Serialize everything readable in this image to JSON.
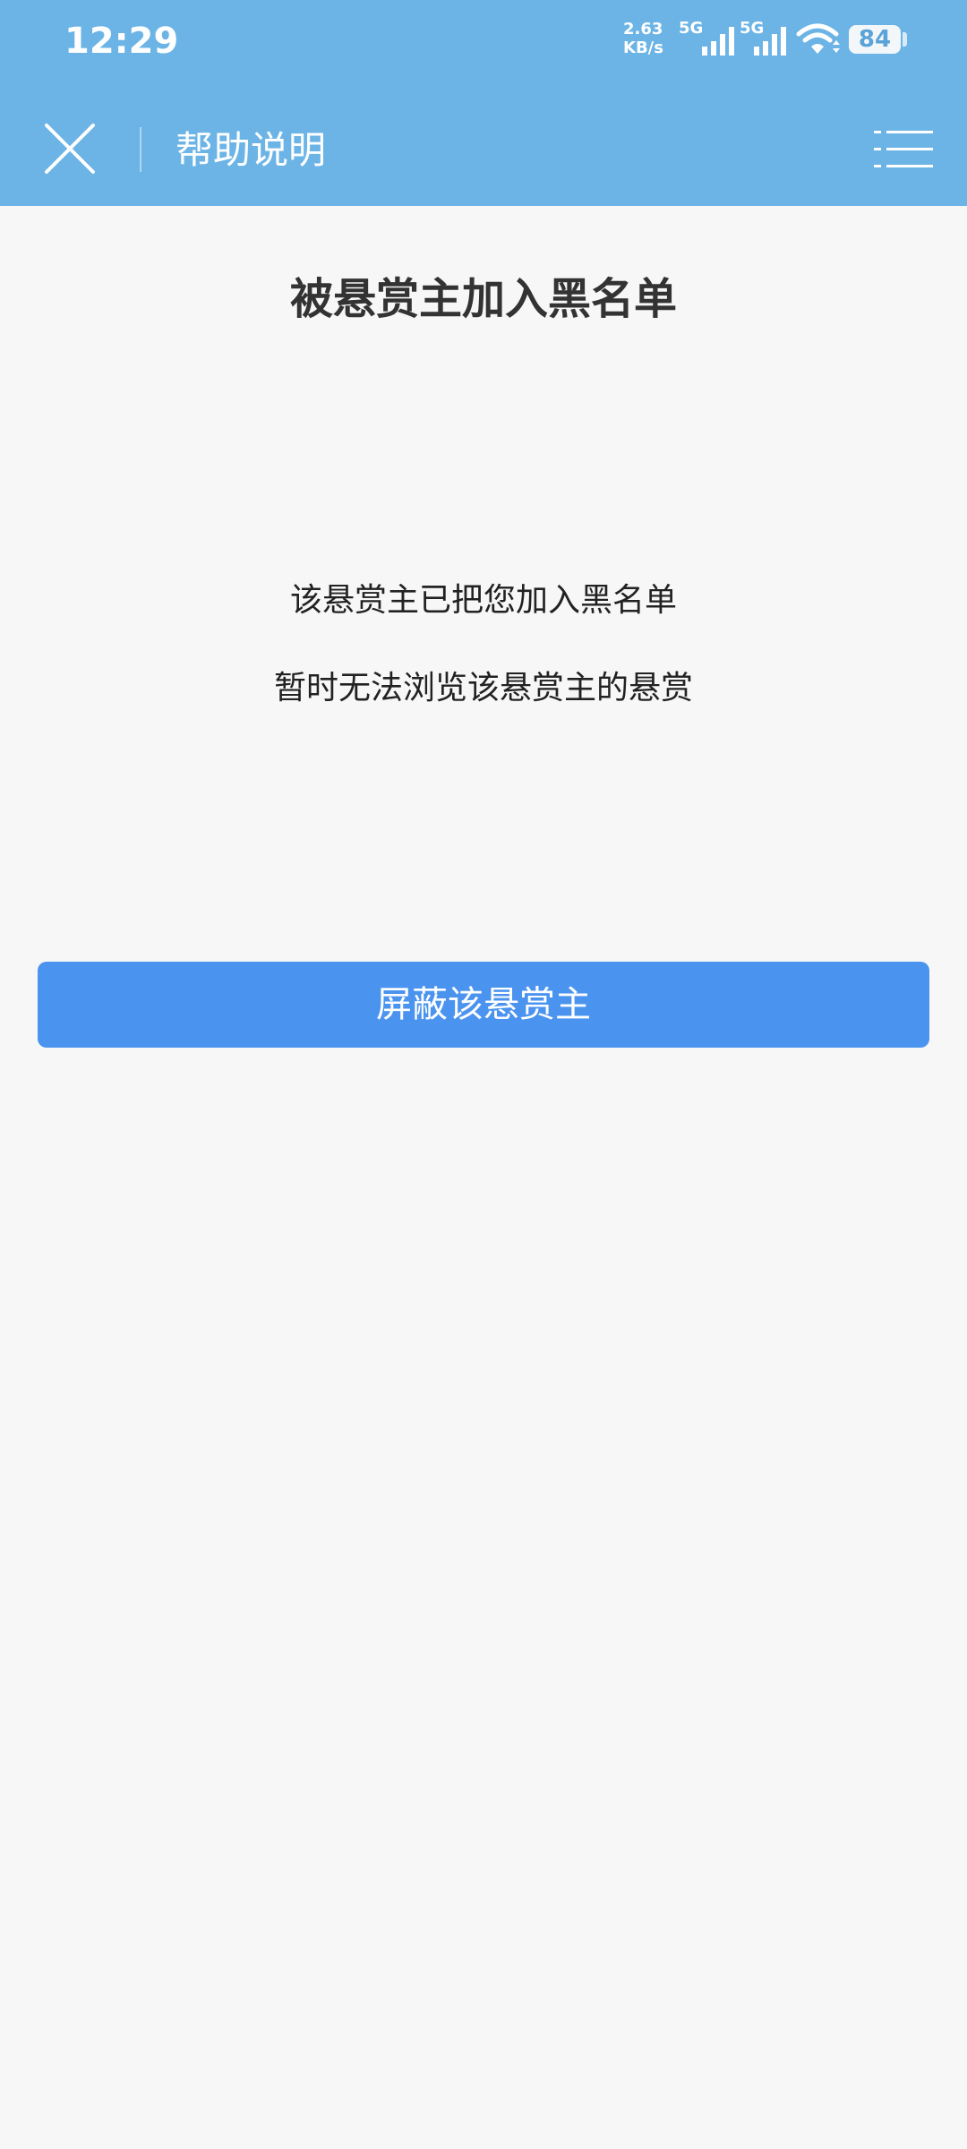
{
  "status_bar": {
    "time": "12:29",
    "speed_value": "2.63",
    "speed_unit": "KB/s",
    "network_1": "5G",
    "network_2": "5G",
    "battery": "84",
    "icons": [
      "signal-icon",
      "signal-icon",
      "wifi-icon",
      "battery-icon"
    ]
  },
  "nav_bar": {
    "title": "帮助说明",
    "close_icon": "close-icon",
    "menu_icon": "menu-icon"
  },
  "content": {
    "title": "被悬赏主加入黑名单",
    "message_line_1": "该悬赏主已把您加入黑名单",
    "message_line_2": "暂时无法浏览该悬赏主的悬赏"
  },
  "actions": {
    "block_button_label": "屏蔽该悬赏主"
  },
  "colors": {
    "header_bg": "#6cb4e6",
    "page_bg": "#f7f7f7",
    "button_bg": "#4a93ef",
    "title_text": "#333333"
  }
}
